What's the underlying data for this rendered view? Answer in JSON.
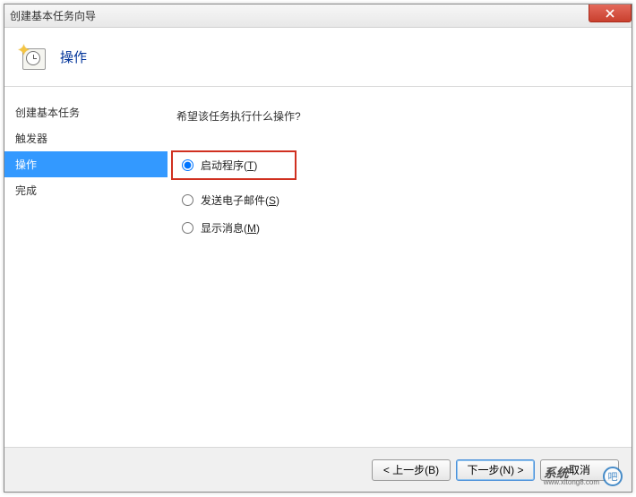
{
  "window": {
    "title": "创建基本任务向导"
  },
  "header": {
    "title": "操作"
  },
  "sidebar": {
    "items": [
      {
        "label": "创建基本任务",
        "selected": false
      },
      {
        "label": "触发器",
        "selected": false
      },
      {
        "label": "操作",
        "selected": true
      },
      {
        "label": "完成",
        "selected": false
      }
    ]
  },
  "content": {
    "prompt": "希望该任务执行什么操作?",
    "options": [
      {
        "label": "启动程序",
        "accel": "T",
        "checked": true,
        "highlight": true
      },
      {
        "label": "发送电子邮件",
        "accel": "S",
        "checked": false,
        "highlight": false
      },
      {
        "label": "显示消息",
        "accel": "M",
        "checked": false,
        "highlight": false
      }
    ]
  },
  "footer": {
    "back": "< 上一步(B)",
    "next": "下一步(N) >",
    "cancel": "取消"
  },
  "watermark": {
    "brand": "系统",
    "url": "www.xitong8.com",
    "logo": "吧"
  }
}
